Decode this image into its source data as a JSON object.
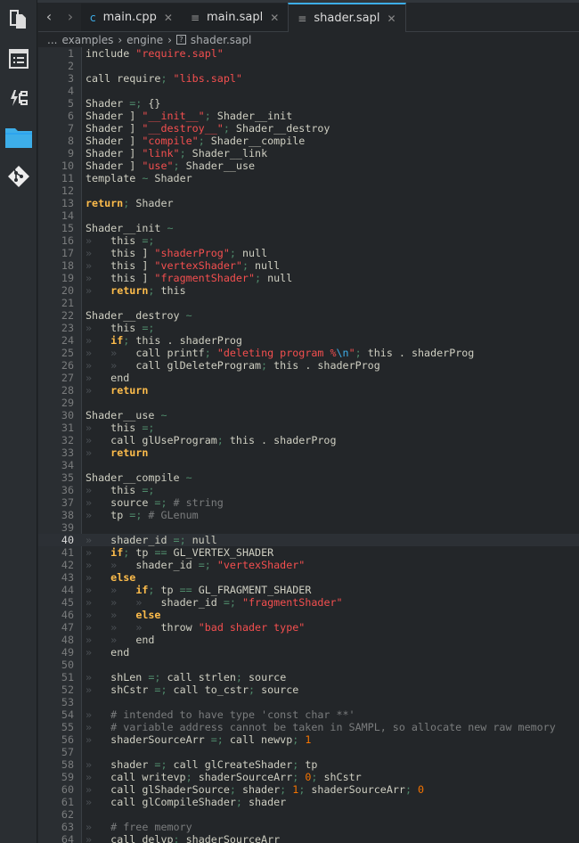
{
  "activity_bar": [
    {
      "icon": "documents-icon"
    },
    {
      "icon": "outline-list-icon"
    },
    {
      "icon": "git-graph-icon"
    },
    {
      "icon": "folder-icon",
      "color": "#3daee9"
    },
    {
      "icon": "git-icon"
    }
  ],
  "tabs": [
    {
      "label": "main.cpp",
      "icon": "cpp-file-icon"
    },
    {
      "label": "main.sapl",
      "icon": "text-file-icon"
    },
    {
      "label": "shader.sapl",
      "icon": "text-file-icon",
      "active": true
    }
  ],
  "breadcrumb": {
    "ellipsis": "...",
    "items": [
      "examples",
      "engine",
      "shader.sapl"
    ]
  },
  "editor": {
    "current_line": 40,
    "first_line": 1,
    "lines": [
      "include \"require.sapl\"",
      "",
      "call require; \"libs.sapl\"",
      "",
      "Shader =; {}",
      "Shader ] \"__init__\"; Shader__init",
      "Shader ] \"__destroy__\"; Shader__destroy",
      "Shader ] \"compile\"; Shader__compile",
      "Shader ] \"link\"; Shader__link",
      "Shader ] \"use\"; Shader__use",
      "template ~ Shader",
      "",
      "return; Shader",
      "",
      "Shader__init ~",
      "\tthis =;",
      "\tthis ] \"shaderProg\"; null",
      "\tthis ] \"vertexShader\"; null",
      "\tthis ] \"fragmentShader\"; null",
      "\treturn; this",
      "",
      "Shader__destroy ~",
      "\tthis =;",
      "\tif; this . shaderProg",
      "\t\tcall printf; \"deleting program %\\n\"; this . shaderProg",
      "\t\tcall glDeleteProgram; this . shaderProg",
      "\tend",
      "\treturn",
      "",
      "Shader__use ~",
      "\tthis =;",
      "\tcall glUseProgram; this . shaderProg",
      "\treturn",
      "",
      "Shader__compile ~",
      "\tthis =;",
      "\tsource =; # string",
      "\ttp =; # GLenum",
      "",
      "\tshader_id =; null",
      "\tif; tp == GL_VERTEX_SHADER",
      "\t\tshader_id =; \"vertexShader\"",
      "\telse",
      "\t\tif; tp == GL_FRAGMENT_SHADER",
      "\t\t\tshader_id =; \"fragmentShader\"",
      "\t\telse",
      "\t\t\tthrow \"bad shader type\"",
      "\t\tend",
      "\tend",
      "",
      "\tshLen =; call strlen; source",
      "\tshCstr =; call to_cstr; source",
      "",
      "\t# intended to have type 'const char **'",
      "\t# variable address cannot be taken in SAMPL, so allocate new raw memory",
      "\tshaderSourceArr =; call newvp; 1",
      "",
      "\tshader =; call glCreateShader; tp",
      "\tcall writevp; shaderSourceArr; 0; shCstr",
      "\tcall glShaderSource; shader; 1; shaderSourceArr; 0",
      "\tcall glCompileShader; shader",
      "",
      "\t# free memory",
      "\tcall delvp; shaderSourceArr"
    ]
  },
  "colors": {
    "accent": "#3daee9",
    "keyword": "#fdbc4b",
    "string": "#f44f4f",
    "comment": "#7a7c7d",
    "background": "#232629"
  }
}
